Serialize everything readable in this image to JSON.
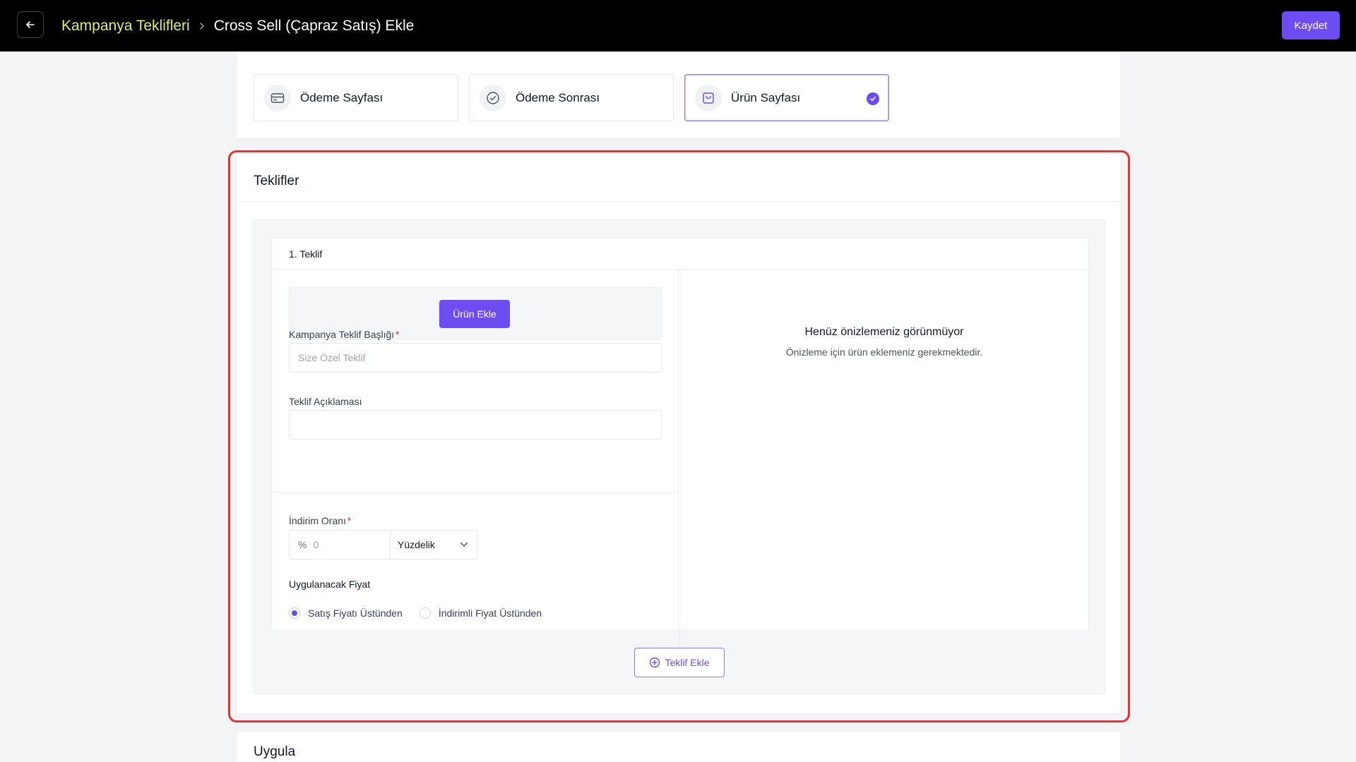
{
  "header": {
    "breadcrumb_parent": "Kampanya Teklifleri",
    "breadcrumb_current": "Cross Sell (Çapraz Satış) Ekle",
    "save_label": "Kaydet"
  },
  "page_types": {
    "options": [
      {
        "label": "Ödeme Sayfası",
        "icon": "credit-card-icon",
        "selected": false
      },
      {
        "label": "Ödeme Sonrası",
        "icon": "check-circle-icon",
        "selected": false
      },
      {
        "label": "Ürün Sayfası",
        "icon": "shopping-bag-icon",
        "selected": true
      }
    ]
  },
  "offers": {
    "title": "Teklifler",
    "items": [
      {
        "heading": "1. Teklif",
        "add_product_label": "Ürün Ekle",
        "title_label": "Kampanya Teklif Başlığı",
        "title_placeholder": "Size Özel Teklif",
        "description_label": "Teklif Açıklaması",
        "description_value": "",
        "discount_label": "İndirim Oranı",
        "discount_prefix": "%",
        "discount_value": "0",
        "discount_type": "Yüzdelik",
        "price_label": "Uygulanacak Fiyat",
        "price_options": [
          {
            "label": "Satış Fiyatı Üstünden",
            "checked": true
          },
          {
            "label": "İndirimli Fiyat Üstünden",
            "checked": false
          }
        ],
        "preview_title": "Henüz önizlemeniz görünmüyor",
        "preview_subtitle": "Önizleme için ürün eklemeniz gerekmektedir."
      }
    ],
    "add_offer_label": "Teklif Ekle"
  },
  "apply": {
    "title": "Uygula"
  },
  "colors": {
    "accent": "#6d4cf2",
    "breadcrumb_parent": "#d9f06a",
    "highlight": "#e5322d"
  }
}
